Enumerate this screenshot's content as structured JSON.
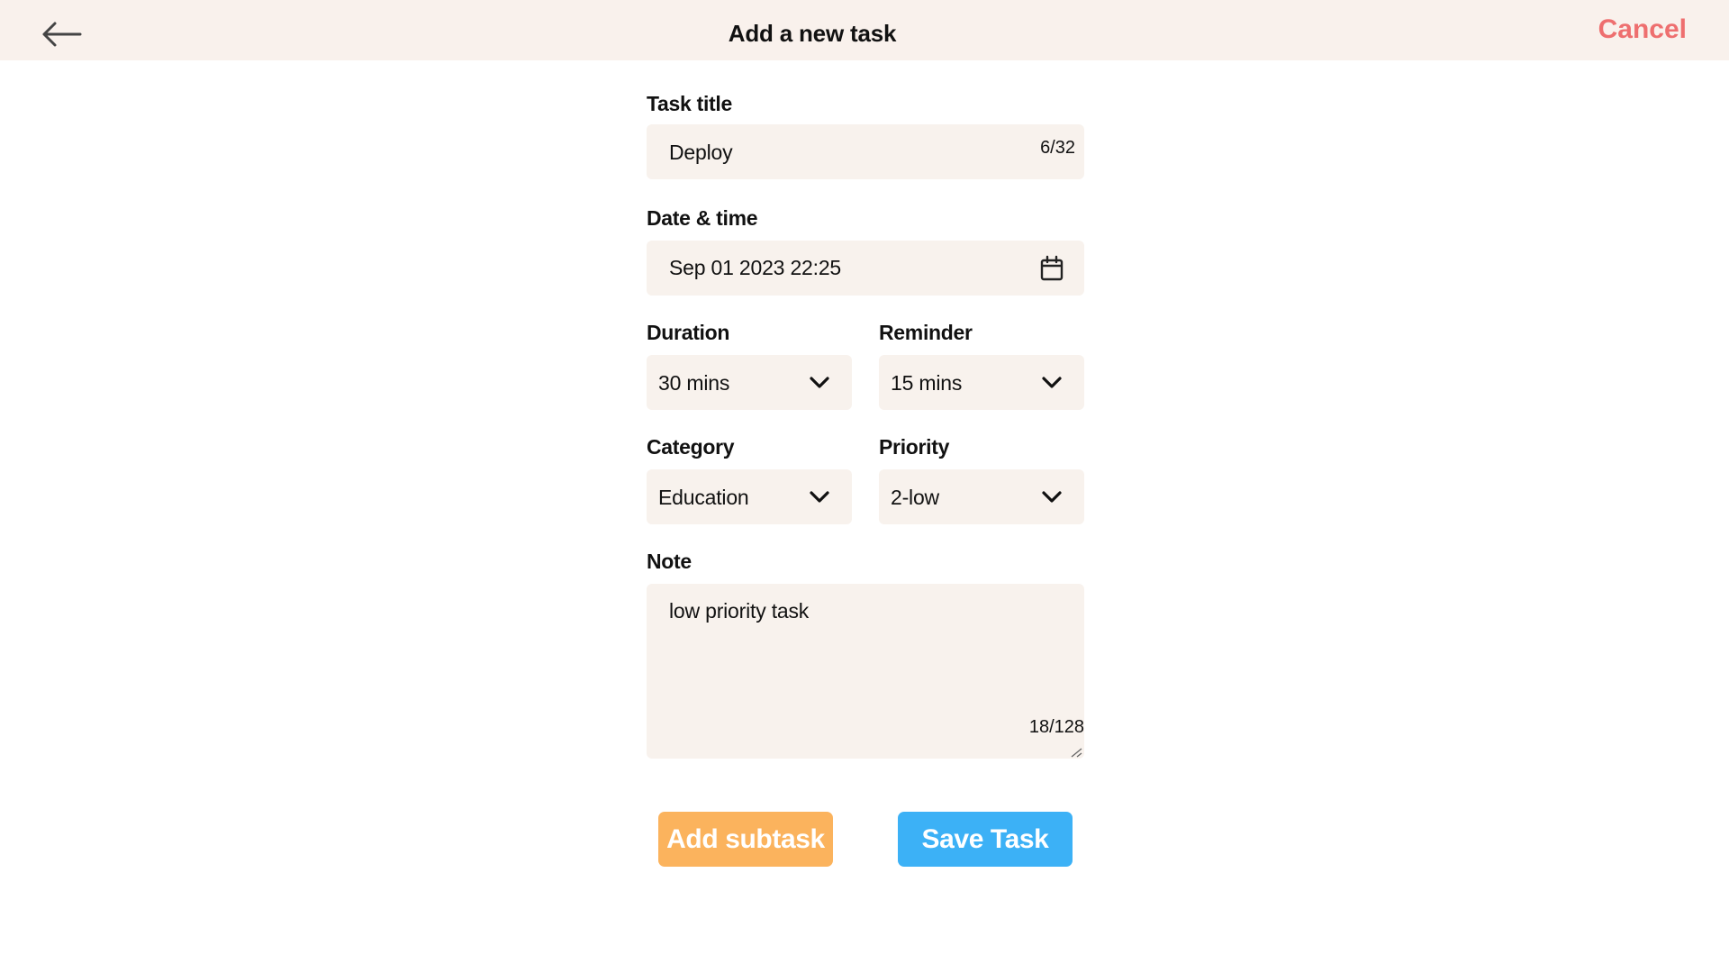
{
  "header": {
    "title": "Add a new task",
    "cancel_label": "Cancel",
    "back_icon": "arrow-left-icon"
  },
  "form": {
    "task_title": {
      "label": "Task title",
      "value": "Deploy",
      "counter": "6/32"
    },
    "date_time": {
      "label": "Date & time",
      "value": "Sep 01 2023 22:25",
      "icon": "calendar-icon"
    },
    "duration": {
      "label": "Duration",
      "value": "30 mins"
    },
    "reminder": {
      "label": "Reminder",
      "value": "15 mins"
    },
    "category": {
      "label": "Category",
      "value": "Education"
    },
    "priority": {
      "label": "Priority",
      "value": "2-low"
    },
    "note": {
      "label": "Note",
      "value": "low priority task",
      "counter": "18/128"
    }
  },
  "actions": {
    "add_subtask_label": "Add subtask",
    "save_task_label": "Save Task"
  },
  "colors": {
    "header_bg": "#f9f1ec",
    "field_bg": "#f8f2ed",
    "cancel": "#ee6f6f",
    "add_subtask": "#fbb35d",
    "save_task": "#3cb1f6"
  }
}
